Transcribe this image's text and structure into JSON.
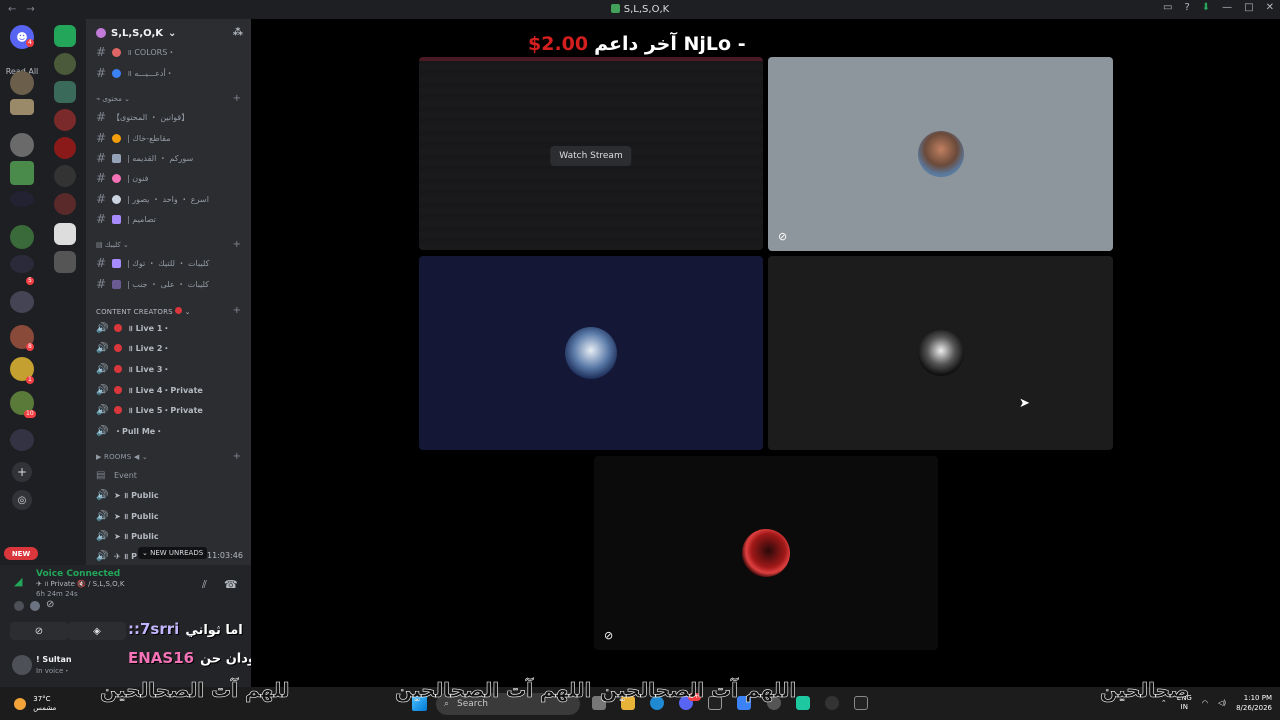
{
  "window": {
    "title": "S,L,S,O,K",
    "nav_back": "←",
    "nav_forward": "→",
    "icons": [
      "inbox-icon",
      "help-icon",
      "download-icon",
      "minimize-icon",
      "maximize-icon",
      "close-icon"
    ]
  },
  "server_rail": {
    "home_badge": "4",
    "read_all": "Read All",
    "badges": [
      "5",
      "8",
      "1",
      "10"
    ]
  },
  "guild": {
    "name": "S,L,S,O,K",
    "chevron": "⌄"
  },
  "channels": {
    "top": [
      {
        "name": "॥ COLORS・",
        "emoji_color": "#e06666"
      },
      {
        "name": "॥ أدعـــيـــه・",
        "emoji_color": "#3b82f6"
      }
    ],
    "category_content": "محتوى",
    "content": [
      {
        "name": "【قوانين ・ المحتوى】",
        "emoji_color": ""
      },
      {
        "name": "| مقاطع-خاك",
        "emoji_color": "#f59e0b"
      },
      {
        "name": "| سوركم ・ القديمه",
        "emoji_color": "#94a3b8"
      },
      {
        "name": "| فنون",
        "emoji_color": "#f472b6"
      },
      {
        "name": "| اسرع ・ واحد ・ يصور",
        "emoji_color": "#cbd5e1"
      },
      {
        "name": "| تصاميم",
        "emoji_color": "#a78bfa"
      }
    ],
    "category_clips": "كليبك",
    "clips": [
      {
        "name": "| كليبات ・ للتيك ・ توك",
        "emoji_color": "#a78bfa"
      },
      {
        "name": "| كليبات ・ على ・ جنب",
        "emoji_color": "#a78bfa"
      }
    ],
    "category_creators": "CONTENT CREATORS",
    "creators": [
      "॥ Live 1・",
      "॥ Live 2・",
      "॥ Live 3・",
      "॥ Live 4・Private",
      "॥ Live 5・Private",
      "・Pull Me・"
    ],
    "category_rooms": "ROOMS",
    "rooms": [
      "Event",
      "➤ ॥ Public",
      "➤ ॥ Public",
      "➤ ॥ Public",
      "✈ ॥ P"
    ]
  },
  "notifications": {
    "new_pill": "NEW",
    "new_unreads": "NEW UNREADS",
    "timer": "11:03:46"
  },
  "voice": {
    "status": "Voice Connected",
    "location": "✈ ॥ Private 🔇 / S,L,S,O,K",
    "elapsed": "6h 24m 24s"
  },
  "user": {
    "name": "! Sultan",
    "status": "In voice・"
  },
  "overlay_chat": [
    {
      "nick": "::7srri",
      "text": "اما ثواني"
    },
    {
      "nick": "ENAS16",
      "text": "اخبار سودان حن"
    }
  ],
  "stage": {
    "supporter_label": "آخر داعم NjLo -",
    "supporter_amount": "$2.00",
    "watch_stream": "Watch Stream"
  },
  "subtitles": [
    "للهم آت الصحالحين",
    "اللهم آت الصحالحين",
    "اللهم آت الصحالحين",
    "صحالحين"
  ],
  "taskbar": {
    "temp": "37°C",
    "weather": "مشمس",
    "search_placeholder": "Search",
    "lang_top": "ENG",
    "lang_bottom": "IN",
    "time": "1:10 PM",
    "date": "8/26/2026",
    "discord_badge": "9+"
  },
  "colors": {
    "online_green": "#23a55a",
    "danger_red": "#da373c",
    "supporter_red": "#d51f1f"
  }
}
